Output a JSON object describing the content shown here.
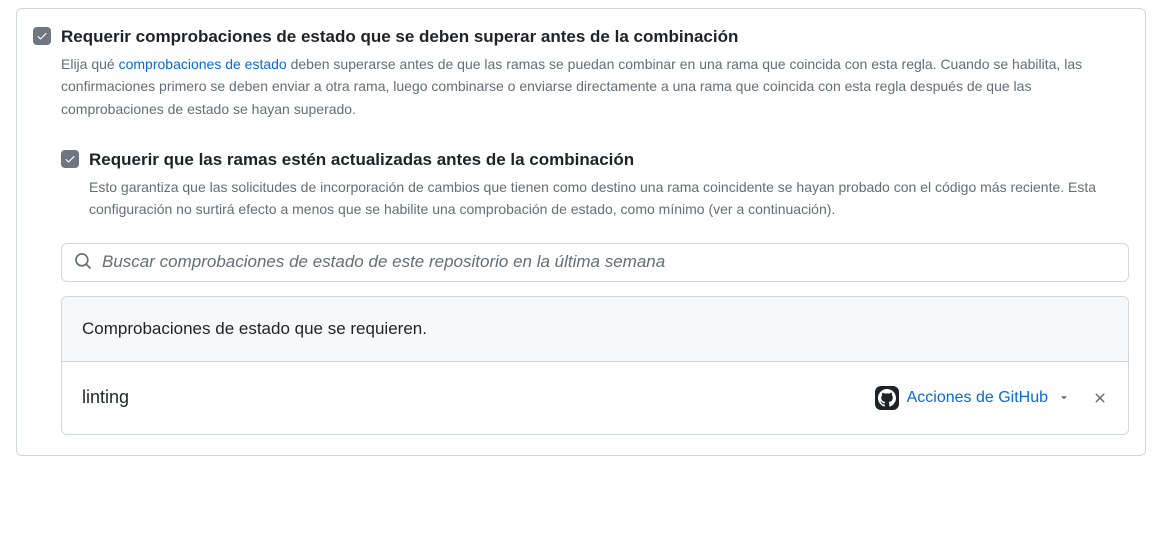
{
  "settings": {
    "requireStatusChecks": {
      "title": "Requerir comprobaciones de estado que se deben superar antes de la combinación",
      "desc_prefix": "Elija qué ",
      "link_text": "comprobaciones de estado",
      "desc_suffix": " deben superarse antes de que las ramas se puedan combinar en una rama que coincida con esta regla. Cuando se habilita, las confirmaciones primero se deben enviar a otra rama, luego combinarse o enviarse directamente a una rama que coincida con esta regla después de que las comprobaciones de estado se hayan superado.",
      "checked": true
    },
    "requireUpToDate": {
      "title": "Requerir que las ramas estén actualizadas antes de la combinación",
      "desc": "Esto garantiza que las solicitudes de incorporación de cambios que tienen como destino una rama coincidente se hayan probado con el código más reciente. Esta configuración no surtirá efecto a menos que se habilite una comprobación de estado, como mínimo (ver a continuación).",
      "checked": true
    }
  },
  "search": {
    "placeholder": "Buscar comprobaciones de estado de este repositorio en la última semana"
  },
  "requiredChecks": {
    "header": "Comprobaciones de estado que se requieren.",
    "items": [
      {
        "name": "linting",
        "source": "Acciones de GitHub"
      }
    ]
  }
}
